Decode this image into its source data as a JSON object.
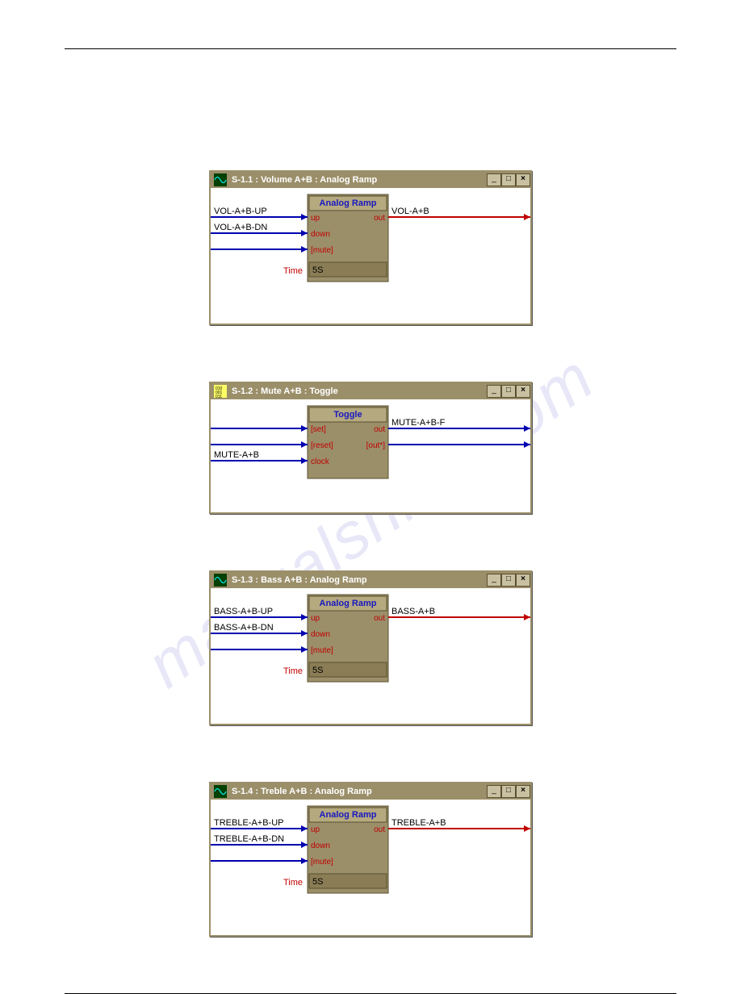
{
  "watermark": "manualshive.com",
  "windows": [
    {
      "icon": "wave",
      "title": "S-1.1 : Volume A+B : Analog Ramp",
      "block": {
        "header": "Analog Ramp",
        "left_ports": [
          "up",
          "down",
          "[mute]"
        ],
        "right_ports": [
          "out"
        ],
        "param_label": "Time",
        "param_value": "5S"
      },
      "inputs": [
        {
          "label": "VOL-A+B-UP",
          "row": 0
        },
        {
          "label": "VOL-A+B-DN",
          "row": 1
        },
        {
          "label": "",
          "row": 2
        }
      ],
      "outputs": [
        {
          "label": "VOL-A+B",
          "row": 0,
          "analog": true
        }
      ]
    },
    {
      "icon": "bits",
      "title": "S-1.2 : Mute A+B : Toggle",
      "block": {
        "header": "Toggle",
        "left_ports": [
          "[set]",
          "[reset]",
          "clock"
        ],
        "right_ports": [
          "out",
          "[out*]"
        ],
        "param_label": "",
        "param_value": ""
      },
      "inputs": [
        {
          "label": "",
          "row": 0
        },
        {
          "label": "",
          "row": 1
        },
        {
          "label": "MUTE-A+B",
          "row": 2
        }
      ],
      "outputs": [
        {
          "label": "MUTE-A+B-F",
          "row": 0,
          "analog": false
        },
        {
          "label": "",
          "row": 1,
          "analog": false
        }
      ]
    },
    {
      "icon": "wave",
      "title": "S-1.3 : Bass A+B : Analog Ramp",
      "block": {
        "header": "Analog Ramp",
        "left_ports": [
          "up",
          "down",
          "[mute]"
        ],
        "right_ports": [
          "out"
        ],
        "param_label": "Time",
        "param_value": "5S"
      },
      "inputs": [
        {
          "label": "BASS-A+B-UP",
          "row": 0
        },
        {
          "label": "BASS-A+B-DN",
          "row": 1
        },
        {
          "label": "",
          "row": 2
        }
      ],
      "outputs": [
        {
          "label": "BASS-A+B",
          "row": 0,
          "analog": true
        }
      ]
    },
    {
      "icon": "wave",
      "title": "S-1.4 : Treble A+B : Analog Ramp",
      "block": {
        "header": "Analog Ramp",
        "left_ports": [
          "up",
          "down",
          "[mute]"
        ],
        "right_ports": [
          "out"
        ],
        "param_label": "Time",
        "param_value": "5S"
      },
      "inputs": [
        {
          "label": "TREBLE-A+B-UP",
          "row": 0
        },
        {
          "label": "TREBLE-A+B-DN",
          "row": 1
        },
        {
          "label": "",
          "row": 2
        }
      ],
      "outputs": [
        {
          "label": "TREBLE-A+B",
          "row": 0,
          "analog": true
        }
      ]
    }
  ]
}
